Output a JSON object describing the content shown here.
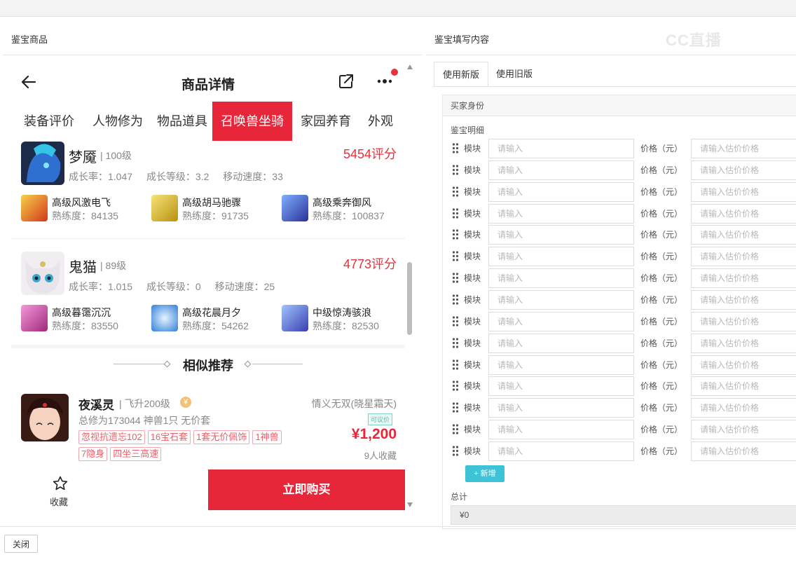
{
  "left_panel": {
    "title": "鉴宝商品"
  },
  "right_panel": {
    "title": "鉴宝填写内容"
  },
  "watermark": "CC直播",
  "phone": {
    "nav_title": "商品详情",
    "tabs": [
      "装备评价",
      "人物修为",
      "物品道具",
      "召唤兽坐骑",
      "家园养育",
      "外观"
    ],
    "active_tab": "召唤兽坐骑",
    "pets": [
      {
        "name": "梦魇",
        "level": "| 100级",
        "score": "5454评分",
        "stats": [
          "成长率：1.047",
          "成长等级：3.2",
          "移动速度：33"
        ],
        "skills": [
          {
            "name": "高级风激电飞",
            "prof": "熟练度：84135",
            "color": "#e0a020"
          },
          {
            "name": "高级胡马驰骤",
            "prof": "熟练度：91735",
            "color": "#d8b020"
          },
          {
            "name": "高级乘奔御风",
            "prof": "熟练度：100837",
            "color": "#3a4fb8"
          }
        ]
      },
      {
        "name": "鬼猫",
        "level": "| 89级",
        "score": "4773评分",
        "stats": [
          "成长率：1.015",
          "成长等级：0",
          "移动速度：25"
        ],
        "skills": [
          {
            "name": "高级暮霭沉沉",
            "prof": "熟练度：83550",
            "color": "#c84aa8"
          },
          {
            "name": "高级花晨月夕",
            "prof": "熟练度：54262",
            "color": "#3a8fd8"
          },
          {
            "name": "中级惊涛骇浪",
            "prof": "熟练度：82530",
            "color": "#4a5fc8"
          }
        ]
      }
    ],
    "recommend_title": "相似推荐",
    "recommend": {
      "name": "夜溪灵",
      "level": "| 飞升200级",
      "server": "情义无双(晓星霜天)",
      "desc": "总修为173044  神兽1只  无价套",
      "tags": [
        "忽视抗遗忘102",
        "16宝石套",
        "1套无价佩饰",
        "1神兽",
        "7隐身",
        "四坐三高速"
      ],
      "badge": "可议价",
      "price": "¥1,200",
      "favorites": "9人收藏"
    },
    "favorite_label": "收藏",
    "buy_label": "立即购买"
  },
  "form": {
    "tabs": [
      "使用新版",
      "使用旧版"
    ],
    "active_tab": "使用新版",
    "buyer_label": "买家身份",
    "detail_label": "鉴宝明细",
    "module_label": "模块",
    "module_placeholder": "请输入",
    "price_label": "价格（元）",
    "price_placeholder": "请输入估价价格",
    "row_count": 15,
    "add_label": "+ 新增",
    "total_label": "总计",
    "total_value": "¥0"
  },
  "footer": {
    "close_label": "关闭"
  }
}
